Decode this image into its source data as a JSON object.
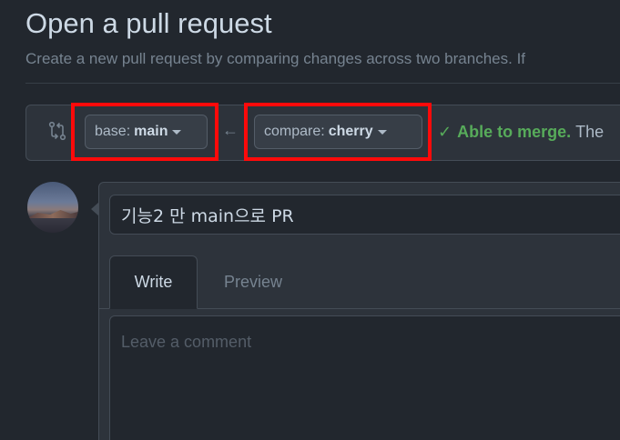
{
  "header": {
    "title": "Open a pull request",
    "subtitle": "Create a new pull request by comparing changes across two branches. If"
  },
  "range": {
    "base_prefix": "base:",
    "base_value": "main",
    "compare_prefix": "compare:",
    "compare_value": "cherry",
    "arrow": "←",
    "merge_check": "✓",
    "merge_status": "Able to merge.",
    "merge_rest": "The"
  },
  "form": {
    "title_value": "기능2 만 main으로 PR",
    "tabs": [
      {
        "label": "Write",
        "selected": true
      },
      {
        "label": "Preview",
        "selected": false
      }
    ],
    "comment_placeholder": "Leave a comment"
  },
  "colors": {
    "background": "#22272e",
    "highlight": "#ff0a0a",
    "success": "#57ab5a"
  },
  "icons": {
    "compare": "git-compare-icon",
    "caret": "triangle-down-icon"
  }
}
